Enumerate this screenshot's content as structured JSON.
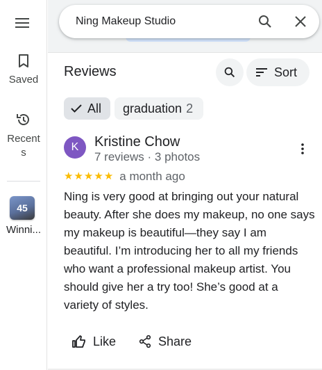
{
  "rail": {
    "saved_label": "Saved",
    "recents_label": "Recent\ns",
    "thumb_badge": "45",
    "thumb_label": "Winni..."
  },
  "search": {
    "value": "Ning Makeup Studio"
  },
  "reviews": {
    "title": "Reviews",
    "sort_label": "Sort",
    "filters": [
      {
        "label": "All",
        "count": "",
        "selected": true
      },
      {
        "label": "graduation",
        "count": "2",
        "selected": false
      }
    ]
  },
  "review": {
    "avatar_letter": "K",
    "avatar_color": "#7e57c2",
    "author": "Kristine Chow",
    "meta": "7 reviews · 3 photos",
    "rating": 5,
    "when": "a month ago",
    "text": "Ning is very good at bringing out your natural beauty. After she does my makeup, no one says my makeup is beautiful—they say I am beautiful. I’m introducing her to all my friends who want a professional makeup artist. You should give her a try too! She’s good at a variety of styles.",
    "like_label": "Like",
    "share_label": "Share"
  },
  "icons": {
    "menu": "menu-icon",
    "saved": "bookmark-icon",
    "recents": "history-icon",
    "search": "search-icon",
    "close": "close-icon",
    "sort": "sort-icon",
    "check": "check-icon",
    "more": "more-vert-icon",
    "like": "thumb-up-icon",
    "share": "share-icon"
  }
}
